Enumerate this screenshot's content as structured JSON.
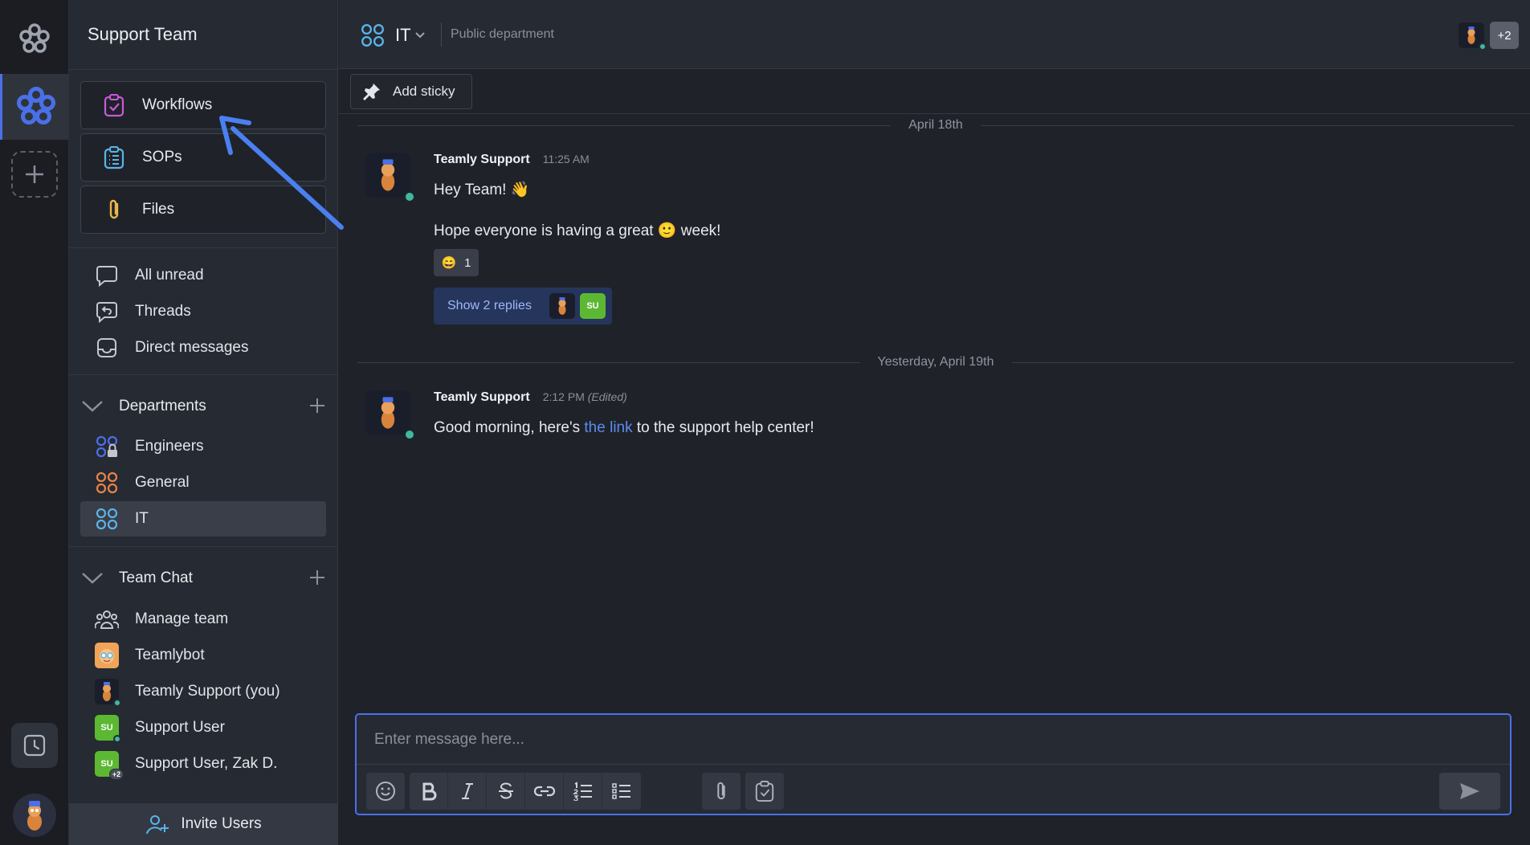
{
  "workspace": {
    "name": "Support Team"
  },
  "sidebar": {
    "quick_links": [
      {
        "label": "Workflows",
        "icon": "workflow-clipboard-icon",
        "color": "#c85ad6"
      },
      {
        "label": "SOPs",
        "icon": "sop-list-icon",
        "color": "#5ab4e8"
      },
      {
        "label": "Files",
        "icon": "paperclip-icon",
        "color": "#e8b64a"
      }
    ],
    "nav": [
      {
        "label": "All unread",
        "icon": "speech-bubble-icon"
      },
      {
        "label": "Threads",
        "icon": "threads-icon"
      },
      {
        "label": "Direct messages",
        "icon": "inbox-icon"
      }
    ],
    "departments": {
      "title": "Departments",
      "items": [
        {
          "label": "Engineers",
          "icon": "private-department-icon",
          "color": "#4a70e8"
        },
        {
          "label": "General",
          "icon": "department-icon",
          "color": "#e8844a"
        },
        {
          "label": "IT",
          "icon": "department-icon",
          "color": "#5ab4e8",
          "active": true
        }
      ]
    },
    "team_chat": {
      "title": "Team Chat",
      "items": [
        {
          "label": "Manage team",
          "icon": "team-icon"
        },
        {
          "label": "Teamlybot",
          "icon": "bot-avatar"
        },
        {
          "label": "Teamly Support (you)",
          "icon": "support-avatar"
        },
        {
          "label": "Support User",
          "avatar_text": "SU"
        },
        {
          "label": "Support User, Zak D.",
          "avatar_text": "SU",
          "badge": "+2"
        }
      ]
    },
    "invite_label": "Invite Users"
  },
  "channel": {
    "name": "IT",
    "description": "Public department",
    "extra_members": "+2"
  },
  "toolbar": {
    "add_sticky_label": "Add sticky"
  },
  "messages": {
    "day1": "April 18th",
    "msg1": {
      "author": "Teamly Support",
      "time": "11:25 AM",
      "line1": "Hey Team! 👋",
      "line2_before": "Hope everyone is having a great ",
      "line2_emoji": "🙂",
      "line2_after": " week!",
      "reaction_emoji": "😄",
      "reaction_count": "1",
      "replies_label": "Show 2 replies",
      "reply_avatar_text": "SU"
    },
    "day2": "Yesterday, April 19th",
    "msg2": {
      "author": "Teamly Support",
      "time": "2:12 PM",
      "edited": "(Edited)",
      "text_before": "Good morning, here's ",
      "link_text": "the link",
      "text_after": " to the support help center!"
    }
  },
  "composer": {
    "placeholder": "Enter message here..."
  },
  "colors": {
    "accent": "#4a70e8",
    "online": "#3fb8a0",
    "su_green": "#5cb832",
    "link": "#5b8cf0"
  }
}
